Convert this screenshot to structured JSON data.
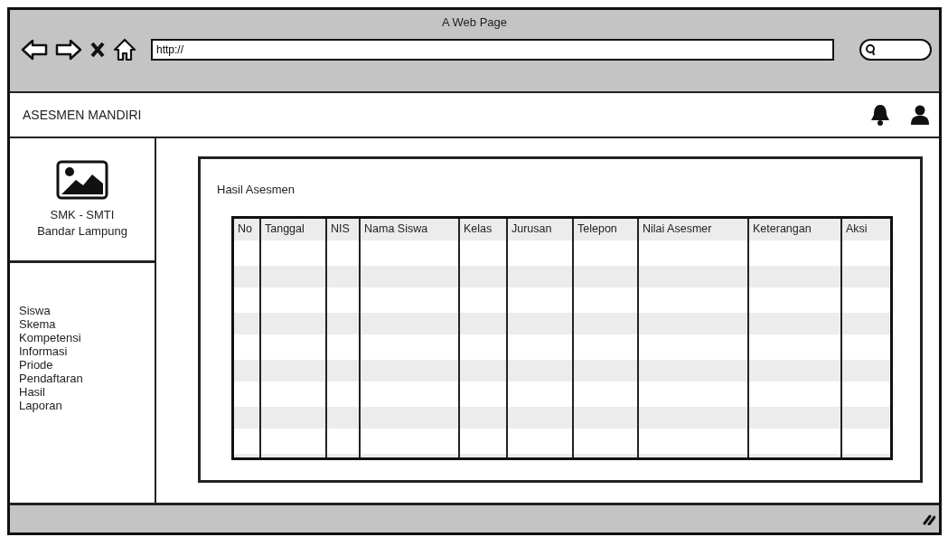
{
  "window": {
    "title": "A Web Page"
  },
  "address_bar": {
    "value": "http://"
  },
  "app_header": {
    "title": "ASESMEN MANDIRI"
  },
  "sidebar": {
    "school_lines": [
      "SMK - SMTI",
      "Bandar Lampung"
    ],
    "items": [
      {
        "label": "Siswa"
      },
      {
        "label": "Skema"
      },
      {
        "label": "Kompetensi"
      },
      {
        "label": "Informasi"
      },
      {
        "label": "Priode"
      },
      {
        "label": "Pendaftaran"
      },
      {
        "label": "Hasil"
      },
      {
        "label": "Laporan"
      }
    ]
  },
  "content": {
    "title": "Hasil Asesmen",
    "table": {
      "columns": [
        "No",
        "Tanggal",
        "NIS",
        "Nama Siswa",
        "Kelas",
        "Jurusan",
        "Telepon",
        "Nilai Asesmer",
        "Keterangan",
        "Aksi"
      ]
    }
  }
}
